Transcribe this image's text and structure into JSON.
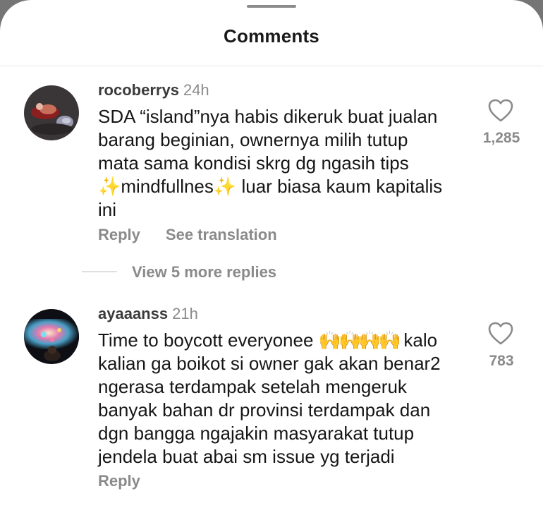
{
  "sheet": {
    "title": "Comments"
  },
  "comments": [
    {
      "username": "rocoberrys",
      "time": "24h",
      "lines": [
        "SDA “island”nya habis dikeruk buat jualan",
        "barang beginian, ownernya milih tutup",
        "mata sama kondisi skrg dg ngasih tips"
      ],
      "line4_emoji_a": "✨",
      "line4_text_a": "mindfullnes",
      "line4_emoji_b": "✨",
      "line4_text_b": " luar biasa kaum kapitalis",
      "line5": "ini",
      "likes": "1,285",
      "reply_label": "Reply",
      "translate_label": "See translation",
      "more_replies": "View 5 more replies"
    },
    {
      "username": "ayaaanss",
      "time": "21h",
      "line1_text": "Time to boycott everyonee ",
      "line1_emoji": "🙌🙌🙌🙌",
      "line1_end": " kalo",
      "lines": [
        "kalian ga boikot si owner gak akan benar2",
        "ngerasa terdampak setelah mengeruk",
        "banyak bahan dr provinsi terdampak dan",
        "dgn bangga ngajakin masyarakat tutup",
        "jendela buat abai sm issue yg terjadi"
      ],
      "likes": "783",
      "reply_label": "Reply"
    }
  ],
  "icons": {
    "like": "heart-outline-icon"
  },
  "colors": {
    "muted": "#8a8a8a",
    "text": "#161616",
    "backdrop": "#757575"
  }
}
